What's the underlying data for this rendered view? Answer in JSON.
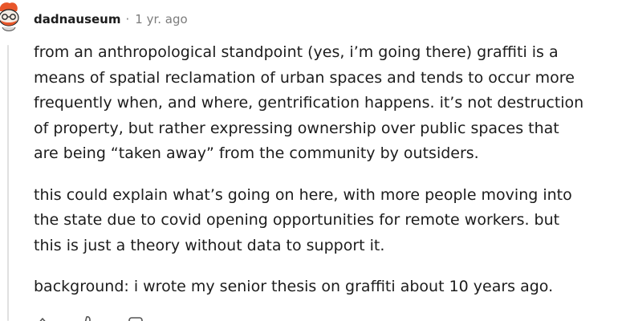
{
  "comment": {
    "author": "dadnauseum",
    "separator": "·",
    "time": "1 yr. ago",
    "paragraphs": [
      {
        "lines": [
          "from an anthropological standpoint (yes, i’m going there) graffiti is a",
          "means of spatial reclamation of urban spaces and tends to occur more",
          "frequently when, and where, gentrification happens. it’s not destruction",
          "of property, but rather expressing ownership over public spaces that",
          "are being “taken away” from the community by outsiders."
        ]
      },
      {
        "lines": [
          "this could explain what’s going on here, with more people moving into",
          "the state due to covid opening opportunities for remote workers. but",
          "this is just a theory without data to support it."
        ]
      },
      {
        "lines": [
          "background: i wrote my senior thesis on graffiti about 10 years ago."
        ]
      }
    ]
  },
  "icons": {
    "avatar": "snoo-avatar-icon",
    "actions": [
      "upvote-icon",
      "downvote-icon",
      "reply-icon"
    ]
  },
  "colors": {
    "text": "#1c1c1c",
    "meta": "#7c7c7c",
    "thread_line": "#e0e0e0",
    "avatar_orange": "#e8562a"
  }
}
